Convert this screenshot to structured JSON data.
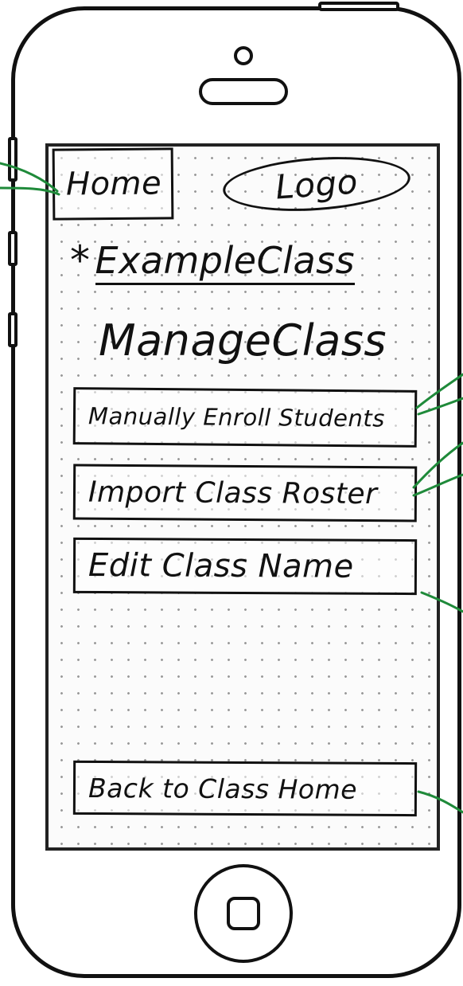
{
  "header": {
    "home_label": "Home",
    "logo_label": "Logo"
  },
  "class_header": {
    "marker": "*",
    "class_name": "ExampleClass"
  },
  "page": {
    "title": "ManageClass"
  },
  "actions": {
    "enroll_label": "Manually Enroll Students",
    "import_label": "Import Class Roster",
    "edit_label": "Edit Class Name"
  },
  "footer": {
    "back_label": "Back to Class Home"
  },
  "colors": {
    "ink": "#111111",
    "annotation_green": "#1f8a3a"
  }
}
